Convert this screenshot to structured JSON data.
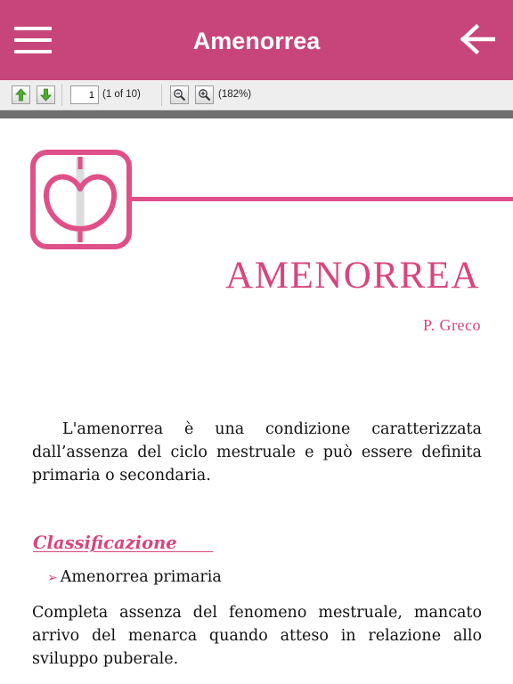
{
  "appbar": {
    "title": "Amenorrea",
    "menu_icon": "hamburger-menu-icon",
    "back_icon": "arrow-left-icon",
    "background": "#c8457a"
  },
  "viewer_toolbar": {
    "prev_icon": "arrow-up-icon",
    "next_icon": "arrow-down-icon",
    "page_number": "1",
    "page_count_text": "(1 of 10)",
    "zoom_out_icon": "zoom-out-icon",
    "zoom_in_icon": "zoom-in-icon",
    "zoom_text": "(182%)"
  },
  "document": {
    "title": "AMENORREA",
    "author": "P. Greco",
    "intro": "L'amenorrea è una condizione caratterizzata dall’assenza del ciclo mestruale e può essere definita primaria o secondaria.",
    "section_heading": "Classificazione",
    "bullet": "Amenorrea primaria",
    "bullet_description": "Completa assenza del fenomeno mestruale, mancato arrivo del menarca quando atteso in relazione allo sviluppo puberale.",
    "accent_color": "#d8457e"
  }
}
